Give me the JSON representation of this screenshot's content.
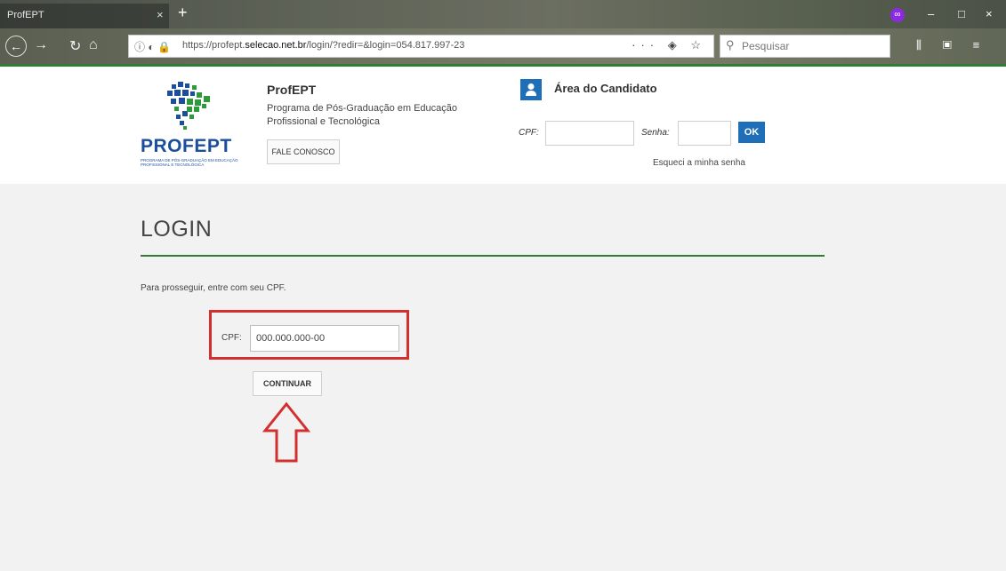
{
  "browser": {
    "tab_title": "ProfEPT",
    "tab_close": "×",
    "new_tab": "+",
    "ext_badge": "∞",
    "url_icons": "ⓘ ◐",
    "url_prefix": "https://profept.",
    "url_domain": "selecao.net.br",
    "url_suffix": "/login/?redir=&login=054.817.997-23",
    "url_actions": "··· ◈ ☆",
    "search_placeholder": "Pesquisar",
    "toolbar_icons": "⫼ ▣ ≡",
    "minimize": "–",
    "maximize": "□",
    "close": "×"
  },
  "header": {
    "logo_word": "PROFEPT",
    "logo_sub": "PROGRAMA DE PÓS-GRADUAÇÃO EM EDUCAÇÃO PROFISSIONAL E TECNOLÓGICA",
    "brand_title": "ProfEPT",
    "brand_desc": "Programa de Pós-Graduação em Educação Profissional e Tecnológica",
    "fale_label": "FALE CONOSCO",
    "area_title": "Área do Candidato",
    "cpf_label": "CPF:",
    "senha_label": "Senha:",
    "ok_label": "OK",
    "esqueci_label": "Esqueci a minha senha"
  },
  "main": {
    "title": "LOGIN",
    "instruction": "Para prosseguir, entre com seu CPF.",
    "cpf_label": "CPF:",
    "cpf_value": "000.000.000-00",
    "continuar_label": "CONTINUAR"
  },
  "colors": {
    "accent_green": "#2e7d32",
    "brand_blue": "#1f6fb8",
    "highlight_red": "#d32f2f"
  }
}
